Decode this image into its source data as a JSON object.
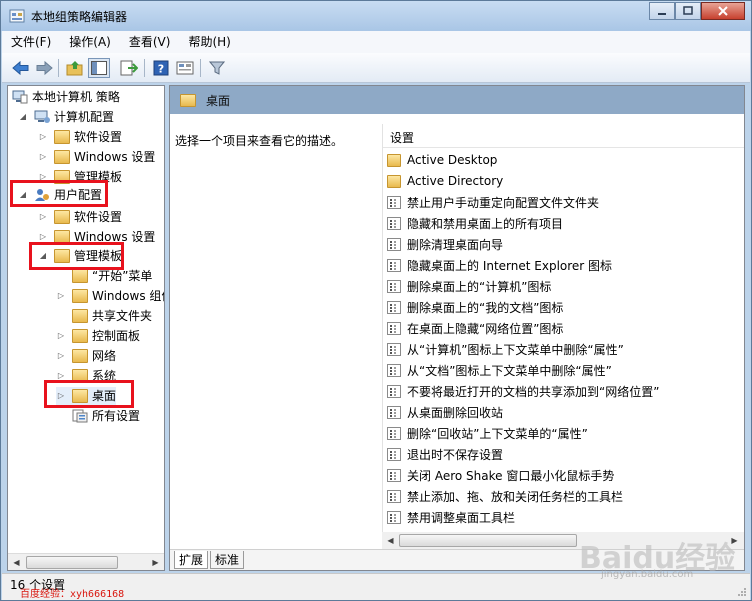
{
  "window": {
    "title": "本地组策略编辑器",
    "controls": {
      "minimize": "─",
      "maximize": "□",
      "close": "✕"
    }
  },
  "menu": [
    {
      "label": "文件(F)"
    },
    {
      "label": "操作(A)"
    },
    {
      "label": "查看(V)"
    },
    {
      "label": "帮助(H)"
    }
  ],
  "toolbar": {
    "icons": [
      "back-arrow-icon",
      "forward-arrow-icon",
      "up-folder-icon",
      "show-hide-tree-icon",
      "export-list-icon",
      "help-icon",
      "properties-view-icon",
      "filter-icon"
    ]
  },
  "tree": {
    "root": "本地计算机 策略",
    "computer_config": "计算机配置",
    "cc_software": "软件设置",
    "cc_windows": "Windows 设置",
    "cc_admin": "管理模板",
    "user_config": "用户配置",
    "uc_software": "软件设置",
    "uc_windows": "Windows 设置",
    "uc_admin": "管理模板",
    "start_menu": "“开始”菜单",
    "windows_components": "Windows 组件",
    "shared_folders": "共享文件夹",
    "control_panel": "控制面板",
    "network": "网络",
    "system": "系统",
    "desktop": "桌面",
    "all_settings": "所有设置"
  },
  "right_pane": {
    "header_title": "桌面",
    "description": "选择一个项目来查看它的描述。",
    "column_header": "设置",
    "folders": [
      "Active Desktop",
      "Active Directory"
    ],
    "settings": [
      "禁止用户手动重定向配置文件文件夹",
      "隐藏和禁用桌面上的所有项目",
      "删除清理桌面向导",
      "隐藏桌面上的 Internet Explorer 图标",
      "删除桌面上的“计算机”图标",
      "删除桌面上的“我的文档”图标",
      "在桌面上隐藏“网络位置”图标",
      "从“计算机”图标上下文菜单中删除“属性”",
      "从“文档”图标上下文菜单中删除“属性”",
      "不要将最近打开的文档的共享添加到“网络位置”",
      "从桌面删除回收站",
      "删除“回收站”上下文菜单的“属性”",
      "退出时不保存设置",
      "关闭 Aero Shake 窗口最小化鼠标手势",
      "禁止添加、拖、放和关闭任务栏的工具栏",
      "禁用调整桌面工具栏"
    ],
    "tabs": [
      {
        "label": "扩展"
      },
      {
        "label": "标准"
      }
    ]
  },
  "status": {
    "text": "16 个设置"
  },
  "watermarks": {
    "author": "百度经验：xyh666168",
    "brand": "Baidu经验",
    "url": "jingyan.baidu.com"
  },
  "colors": {
    "highlight_box": "#e8121d",
    "header_band": "#8ea9c6",
    "window_frame": "#bcd3ea"
  }
}
